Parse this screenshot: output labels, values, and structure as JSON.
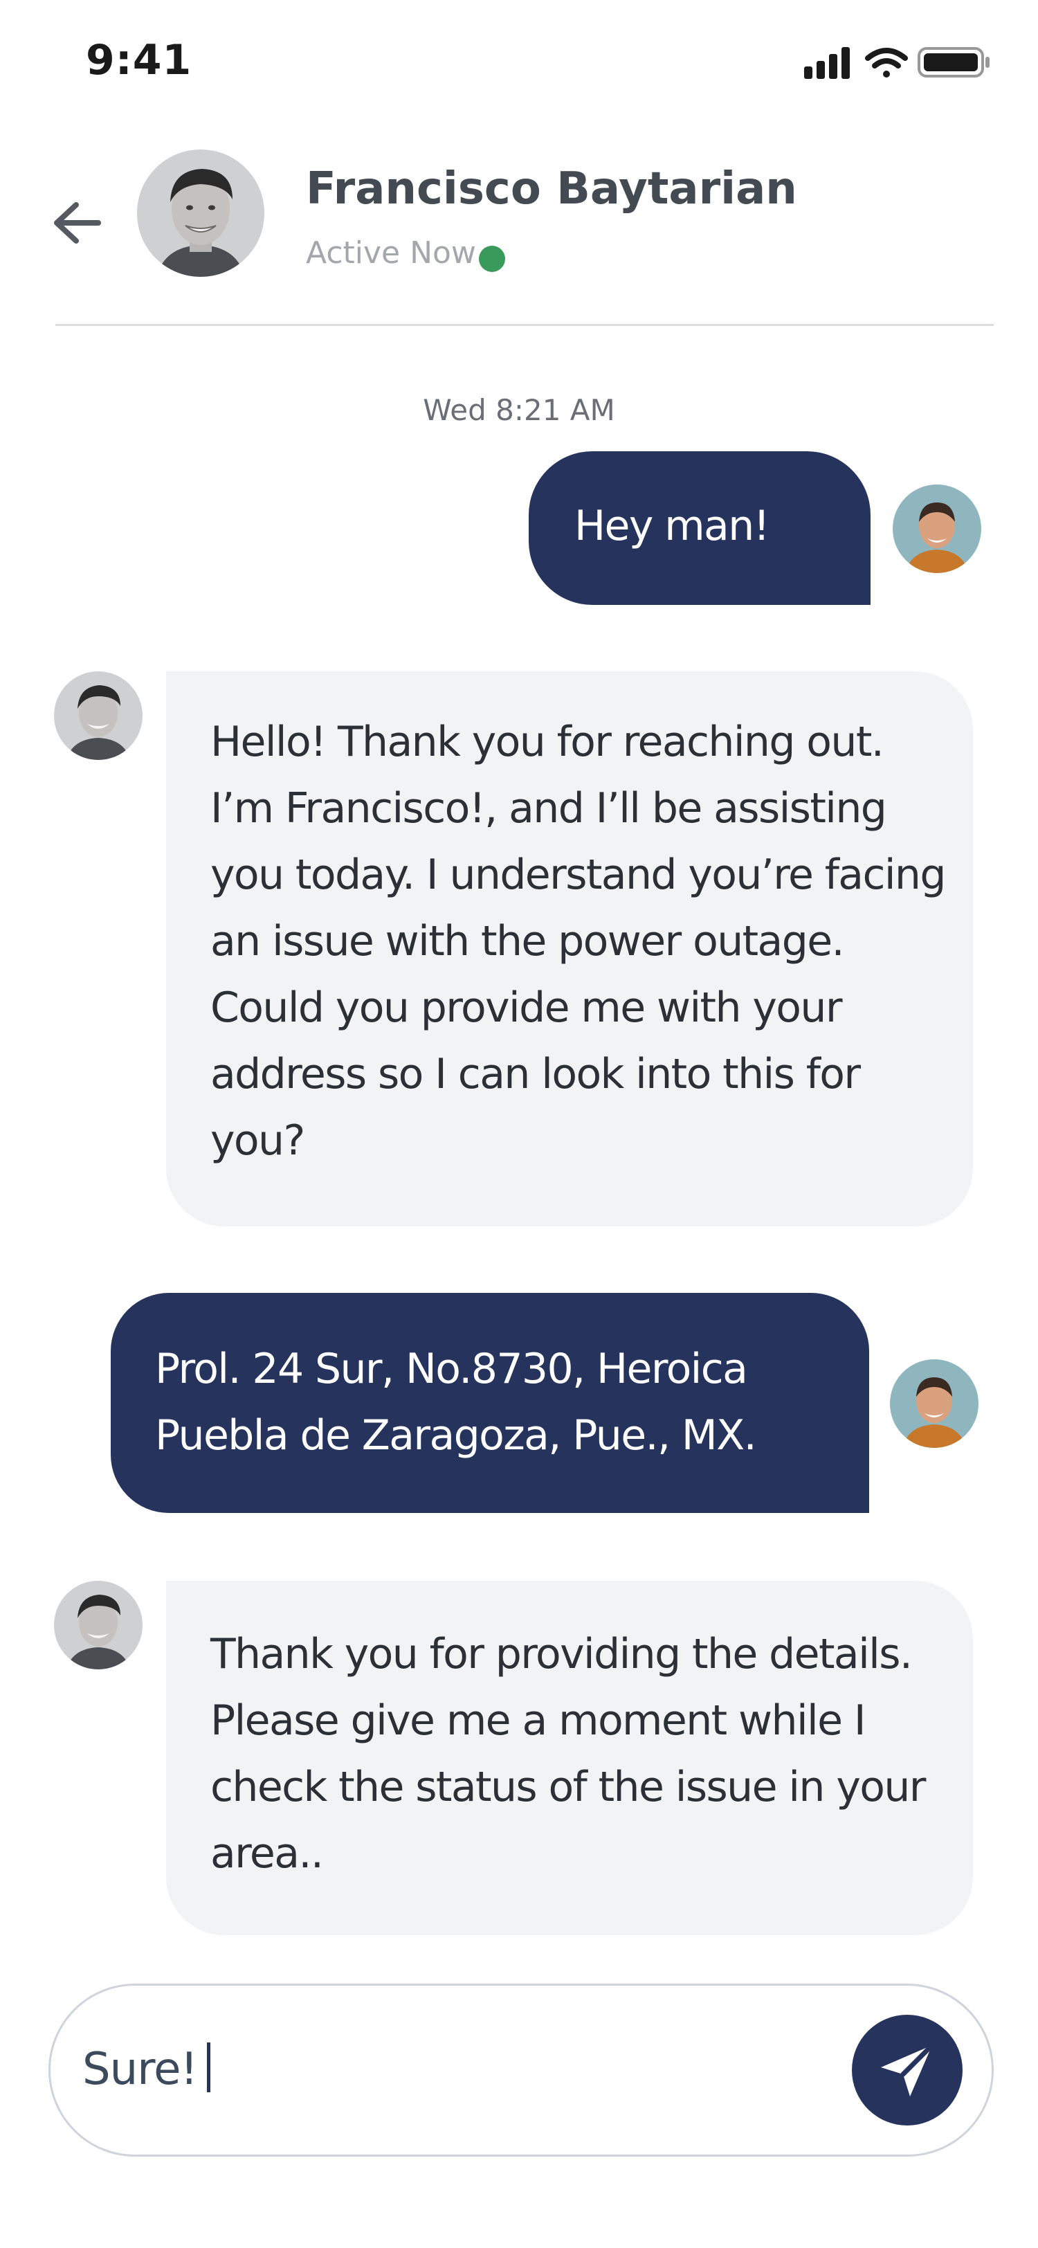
{
  "status_bar": {
    "time": "9:41",
    "signal_icon": "cellular-signal-icon",
    "wifi_icon": "wifi-icon",
    "battery_icon": "battery-icon"
  },
  "header": {
    "back_icon": "arrow-left-icon",
    "contact_name": "Francisco Baytarian",
    "status_text": "Active Now",
    "status_color": "#3a9a5b"
  },
  "conversation": {
    "timestamp": "Wed 8:21 AM",
    "messages": [
      {
        "from": "me",
        "text": "Hey man!"
      },
      {
        "from": "contact",
        "text": "Hello!  Thank you for reaching out. I’m Francisco!, and I’ll be assisting you today. I understand you’re facing an issue with the power outage. Could you provide me with your address so I can look into this for you?"
      },
      {
        "from": "me",
        "text": "Prol. 24 Sur, No.8730, Heroica Puebla de Zaragoza, Pue., MX."
      },
      {
        "from": "contact",
        "text": "Thank you for providing the details. Please give me a moment while I check the status of the issue in your area.."
      }
    ]
  },
  "composer": {
    "value": "Sure!",
    "send_icon": "send-icon"
  },
  "colors": {
    "accent": "#26335c",
    "received_bubble": "#f2f3f5",
    "online": "#3a9a5b"
  }
}
